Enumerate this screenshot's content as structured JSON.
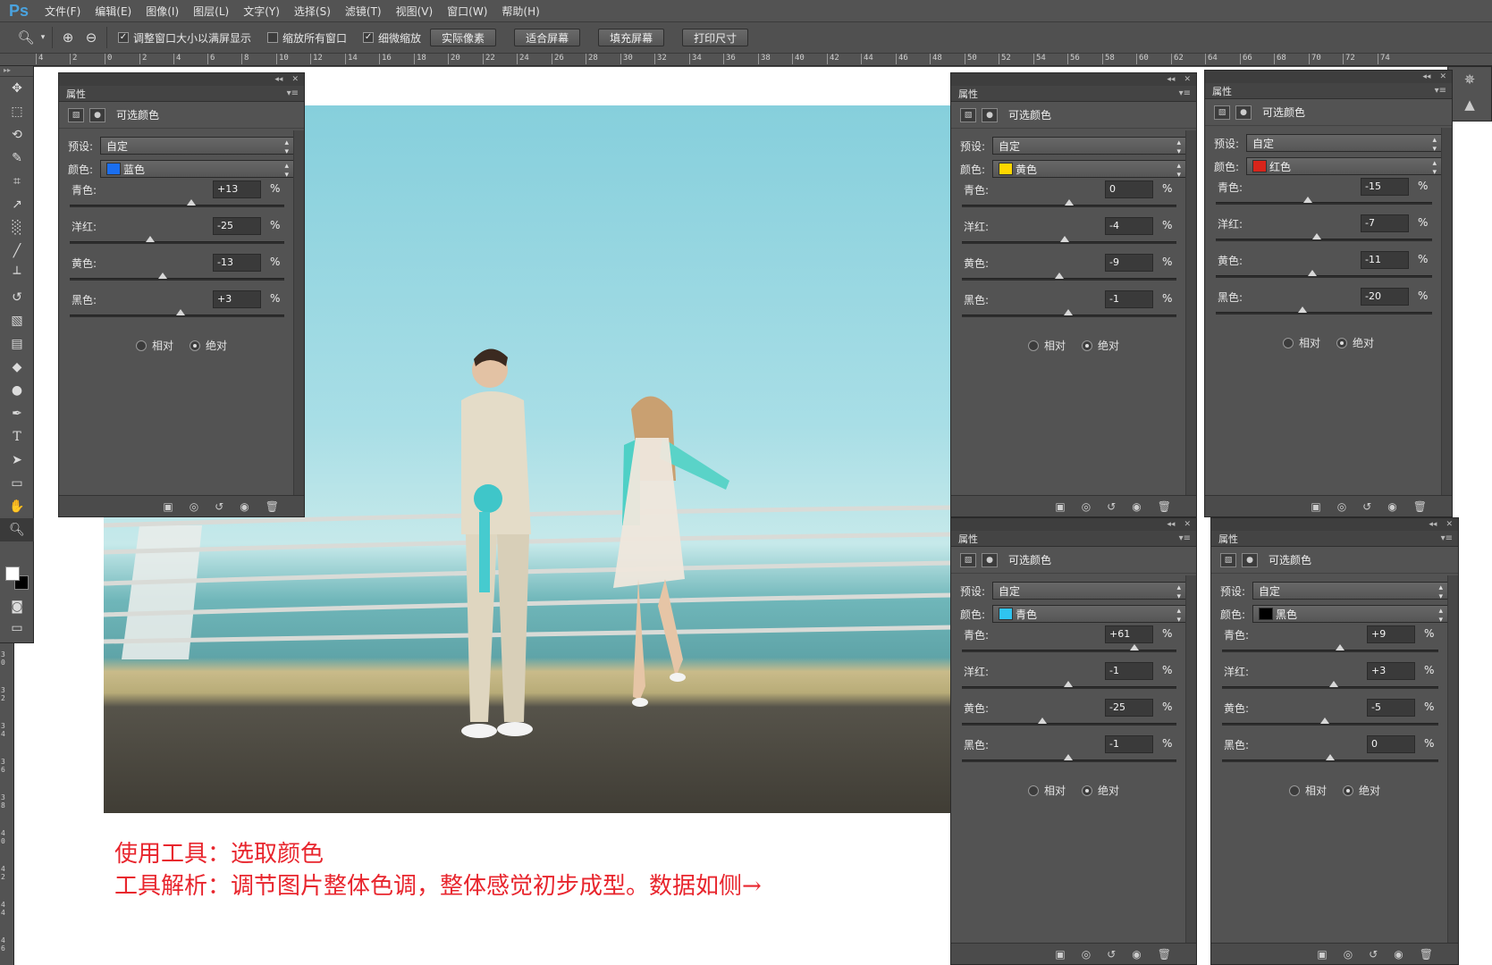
{
  "app": {
    "logo": "Ps"
  },
  "menu": [
    "文件(F)",
    "编辑(E)",
    "图像(I)",
    "图层(L)",
    "文字(Y)",
    "选择(S)",
    "滤镜(T)",
    "视图(V)",
    "窗口(W)",
    "帮助(H)"
  ],
  "options": {
    "checkbox_resize": "调整窗口大小以满屏显示",
    "checkbox_all_windows": "缩放所有窗口",
    "checkbox_scrubby": "细微缩放",
    "btn_actual": "实际像素",
    "btn_fit": "适合屏幕",
    "btn_fill": "填充屏幕",
    "btn_print": "打印尺寸"
  },
  "ruler": [
    "4",
    "2",
    "0",
    "2",
    "4",
    "6",
    "8",
    "10",
    "12",
    "14",
    "16",
    "18",
    "20",
    "22",
    "24",
    "26",
    "28",
    "30",
    "32",
    "34",
    "36",
    "38",
    "40",
    "42",
    "44",
    "46",
    "48",
    "50",
    "52",
    "54",
    "56",
    "58",
    "60",
    "62",
    "64",
    "66",
    "68",
    "70",
    "72",
    "74"
  ],
  "vruler": [
    "3 0",
    "3 2",
    "3 4",
    "3 6",
    "3 8",
    "4 0",
    "4 2",
    "4 4",
    "4 6"
  ],
  "caption": {
    "line1": "使用工具：选取颜色",
    "line2": "工具解析：调节图片整体色调，整体感觉初步成型。数据如侧→"
  },
  "panel_common": {
    "tab": "属性",
    "header": "可选颜色",
    "preset_label": "预设:",
    "preset_value": "自定",
    "color_label": "颜色:",
    "slider_labels": [
      "青色:",
      "洋红:",
      "黄色:",
      "黑色:"
    ],
    "pct": "%",
    "radio_relative": "相对",
    "radio_absolute": "绝对"
  },
  "panels": [
    {
      "color_name": "蓝色",
      "swatch": "#1a6ef0",
      "values": [
        "+13",
        "-25",
        "-13",
        "+3"
      ],
      "positions": [
        0.565,
        0.375,
        0.435,
        0.515
      ]
    },
    {
      "color_name": "黄色",
      "swatch": "#ffd800",
      "values": [
        "0",
        "-4",
        "-9",
        "-1"
      ],
      "positions": [
        0.5,
        0.48,
        0.455,
        0.495
      ]
    },
    {
      "color_name": "红色",
      "swatch": "#d8241a",
      "values": [
        "-15",
        "-7",
        "-11",
        "-20"
      ],
      "positions": [
        0.425,
        0.465,
        0.445,
        0.4
      ]
    },
    {
      "color_name": "青色",
      "swatch": "#2fc4f0",
      "values": [
        "+61",
        "-1",
        "-25",
        "-1"
      ],
      "positions": [
        0.805,
        0.495,
        0.375,
        0.495
      ]
    },
    {
      "color_name": "黑色",
      "swatch": "#000000",
      "values": [
        "+9",
        "+3",
        "-5",
        "0"
      ],
      "positions": [
        0.545,
        0.515,
        0.475,
        0.5
      ]
    }
  ]
}
